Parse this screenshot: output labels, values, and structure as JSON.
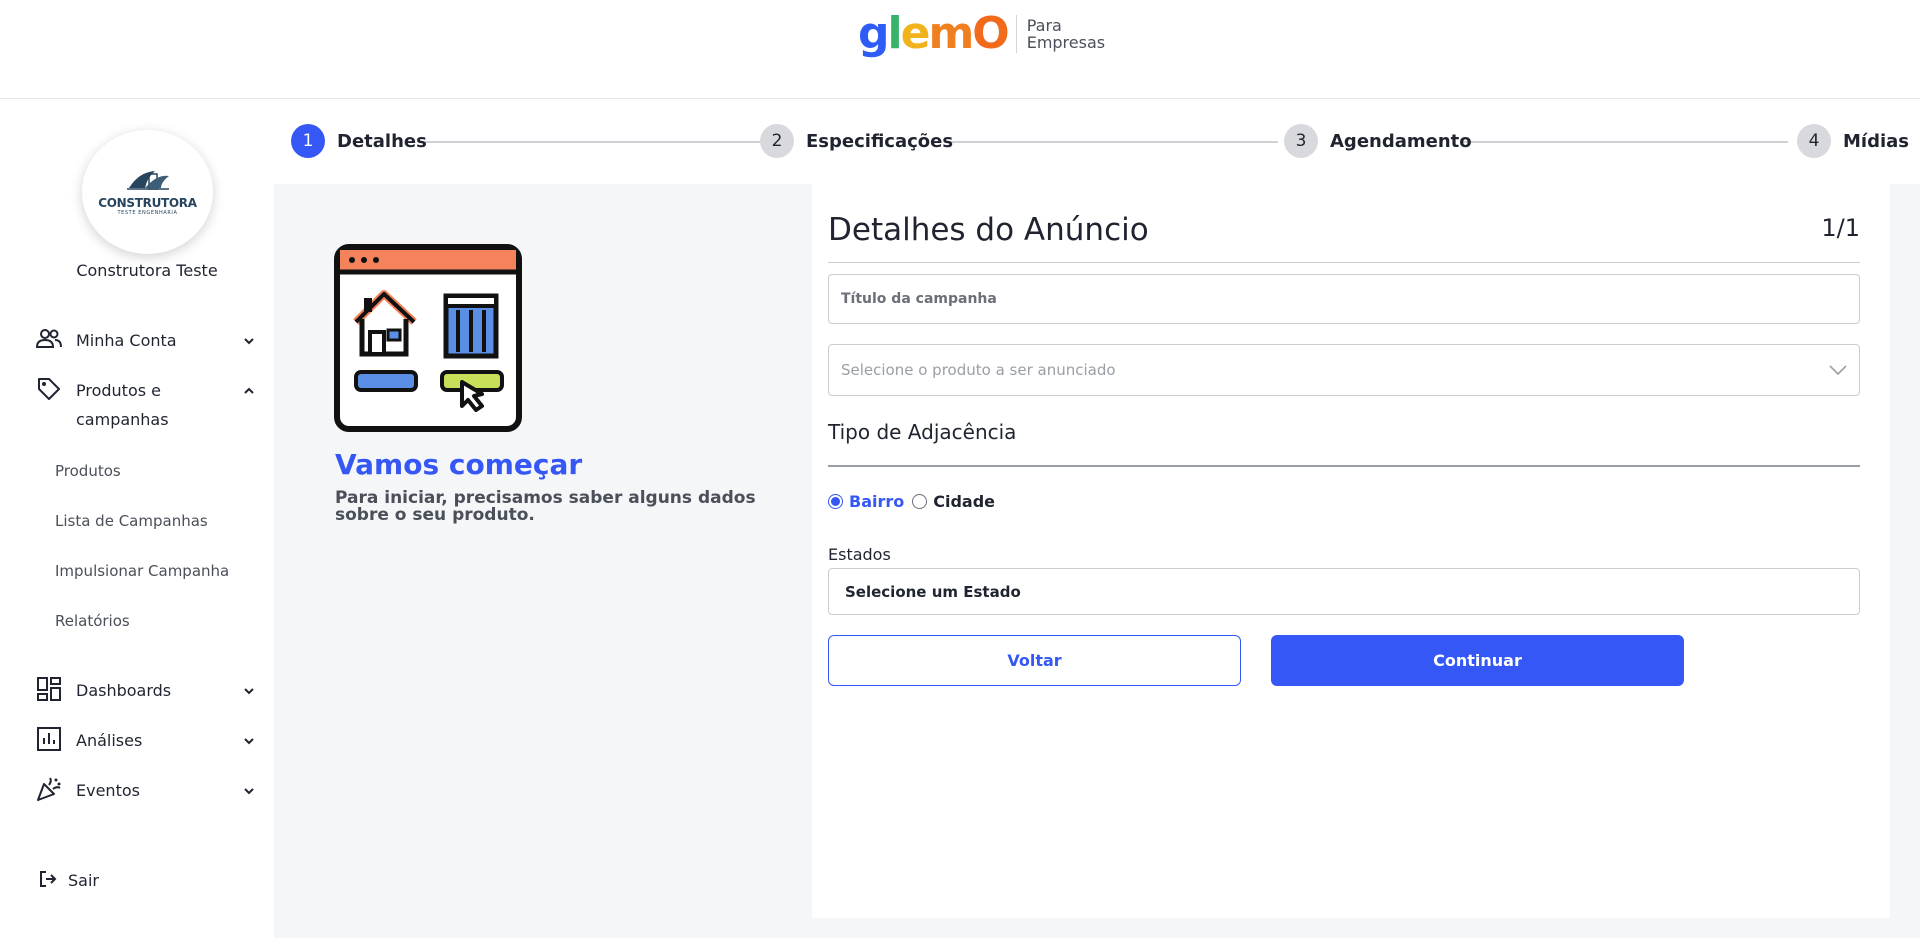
{
  "header": {
    "logo_text": "glemO",
    "logo_tag_line1": "Para",
    "logo_tag_line2": "Empresas"
  },
  "sidebar": {
    "avatar_brand": "CONSTRUTORA",
    "avatar_sub": "TESTE ENGENHARIA",
    "company_name": "Construtora Teste",
    "items": [
      {
        "label": "Minha Conta",
        "icon": "people-icon",
        "expanded": false
      },
      {
        "label": "Produtos e campanhas",
        "icon": "tag-icon",
        "expanded": true
      },
      {
        "label": "Dashboards",
        "icon": "dashboard-icon",
        "expanded": false
      },
      {
        "label": "Análises",
        "icon": "bar-chart-icon",
        "expanded": false
      },
      {
        "label": "Eventos",
        "icon": "party-icon",
        "expanded": false
      }
    ],
    "sub_items": [
      "Produtos",
      "Lista de Campanhas",
      "Impulsionar Campanha",
      "Relatórios"
    ],
    "logout_label": "Sair"
  },
  "stepper": {
    "steps": [
      {
        "number": "1",
        "label": "Detalhes",
        "active": true
      },
      {
        "number": "2",
        "label": "Especificações",
        "active": false
      },
      {
        "number": "3",
        "label": "Agendamento",
        "active": false
      },
      {
        "number": "4",
        "label": "Mídias",
        "active": false
      }
    ]
  },
  "intro": {
    "title": "Vamos começar",
    "text": "Para iniciar, precisamos saber alguns dados sobre o seu produto."
  },
  "form": {
    "title": "Detalhes do Anúncio",
    "page": "1/1",
    "campaign_title_placeholder": "Título da campanha",
    "product_select_placeholder": "Selecione o produto a ser anunciado",
    "adjacency_label": "Tipo de Adjacência",
    "radio_options": [
      {
        "label": "Bairro",
        "selected": true
      },
      {
        "label": "Cidade",
        "selected": false
      }
    ],
    "states_label": "Estados",
    "states_value": "Selecione um Estado",
    "back_label": "Voltar",
    "continue_label": "Continuar"
  },
  "colors": {
    "accent": "#3557f5",
    "panel_bg": "#f5f6f8"
  }
}
